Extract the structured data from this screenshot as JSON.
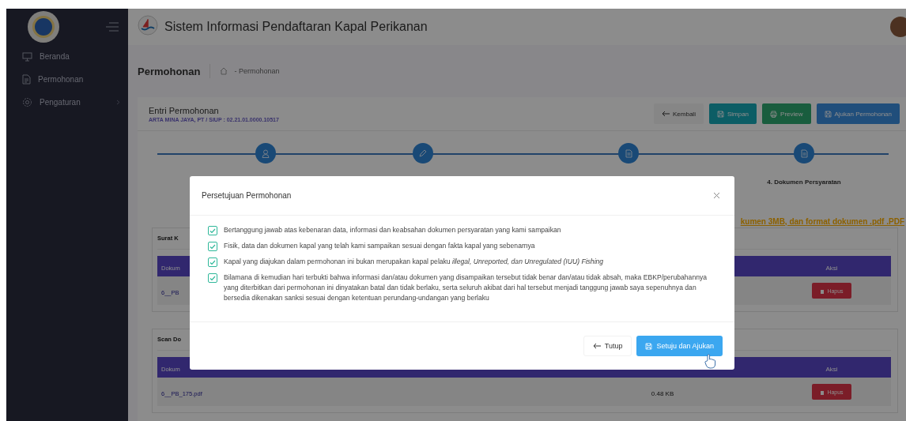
{
  "sidebar": {
    "items": [
      {
        "label": "Beranda",
        "kind": "monitor",
        "submenu": false
      },
      {
        "label": "Permohonan",
        "kind": "document",
        "submenu": false
      },
      {
        "label": "Pengaturan",
        "kind": "gear",
        "submenu": true
      }
    ]
  },
  "header": {
    "title": "Sistem Informasi Pendaftaran Kapal Perikanan"
  },
  "breadcrumb": {
    "title": "Permohonan",
    "trail": "- Permohonan"
  },
  "card": {
    "title": "Entri Permohonan",
    "subtitle": "ARTA MINA JAYA, PT / SIUP : 02.21.01.0000.10517",
    "buttons": [
      {
        "label": "Kembali",
        "kind": "back"
      },
      {
        "label": "Simpan",
        "kind": "save"
      },
      {
        "label": "Preview",
        "kind": "print"
      },
      {
        "label": "Ajukan Permohonan",
        "kind": "submit"
      }
    ]
  },
  "steps": [
    {
      "kind": "user"
    },
    {
      "kind": "pencil"
    },
    {
      "kind": "document"
    },
    {
      "kind": "document",
      "label": "4. Dokumen Persyaratan"
    }
  ],
  "notice": "kumen 3MB, dan format dokumen .pdf .PDF",
  "sections": [
    {
      "title": "Surat K",
      "header": {
        "document": "Dokum",
        "action": "Aksi"
      },
      "rows": [
        {
          "file": "6__PB",
          "action": "Hapus"
        }
      ]
    },
    {
      "title": "Scan Do",
      "header": {
        "document": "Dokum",
        "action": "Aksi"
      },
      "rows": [
        {
          "file": "6__PB_175.pdf",
          "size": "0.48 KB",
          "action": "Hapus"
        }
      ]
    }
  ],
  "modal": {
    "title": "Persetujuan Permohonan",
    "items": [
      {
        "text": "Bertanggung jawab atas kebenaran data, informasi dan keabsahan dokumen persyaratan yang kami sampaikan",
        "checked": true
      },
      {
        "text": "Fisik, data dan dokumen kapal yang telah kami sampaikan sesuai dengan fakta kapal yang sebenarnya",
        "checked": true
      },
      {
        "text": "Kapal yang diajukan dalam permohonan ini bukan merupakan kapal pelaku *illegal, Unreported, dan Unregulated (IUU) Fishing*",
        "checked": true
      },
      {
        "text": "Bilamana di kemudian hari terbukti bahwa informasi dan/atau dokumen yang disampaikan tersebut tidak benar dan/atau tidak absah, maka EBKP/perubahannya yang diterbitkan dari permohonan ini dinyatakan batal dan tidak berlaku, serta seluruh akibat dari hal tersebut menjadi tanggung jawab saya sepenuhnya dan bersedia dikenakan sanksi sesuai dengan ketentuan perundang-undangan yang berlaku",
        "checked": true
      }
    ],
    "buttons": [
      {
        "label": "Tutup",
        "kind": "back"
      },
      {
        "label": "Setuju dan Ajukan",
        "kind": "submit"
      }
    ]
  }
}
